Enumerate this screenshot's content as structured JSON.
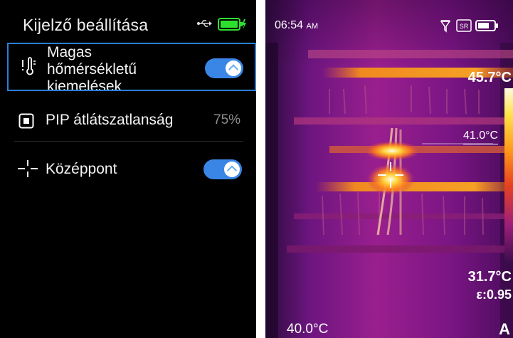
{
  "settings_screen": {
    "title": "Kijelző beállítása",
    "status": {
      "usb_icon": "usb-icon",
      "battery_icon": "battery-charging-icon",
      "battery_color": "#2ee02e"
    },
    "items": [
      {
        "label_line1": "Magas",
        "label_line2": "hőmérsékletű",
        "label_line3": "kiemelések",
        "icon": "thermometer-alert-icon",
        "toggle": true,
        "selected": true
      },
      {
        "label": "PIP átlátszatlanság",
        "icon": "pip-icon",
        "value": "75%"
      },
      {
        "label": "Középpont",
        "icon": "crosshair-icon",
        "toggle": true
      }
    ],
    "accent_color": "#2c7fd6"
  },
  "thermal_screen": {
    "time": "06:54",
    "ampm": "AM",
    "status_icons": [
      "filter-icon",
      "sr-icon",
      "battery-icon"
    ],
    "max_temp": "45.7°C",
    "cursor_temp": "41.0°C",
    "min_temp": "31.7°C",
    "emissivity": "ε:0.95",
    "center_temp": "40.0°C",
    "mode": "A"
  }
}
